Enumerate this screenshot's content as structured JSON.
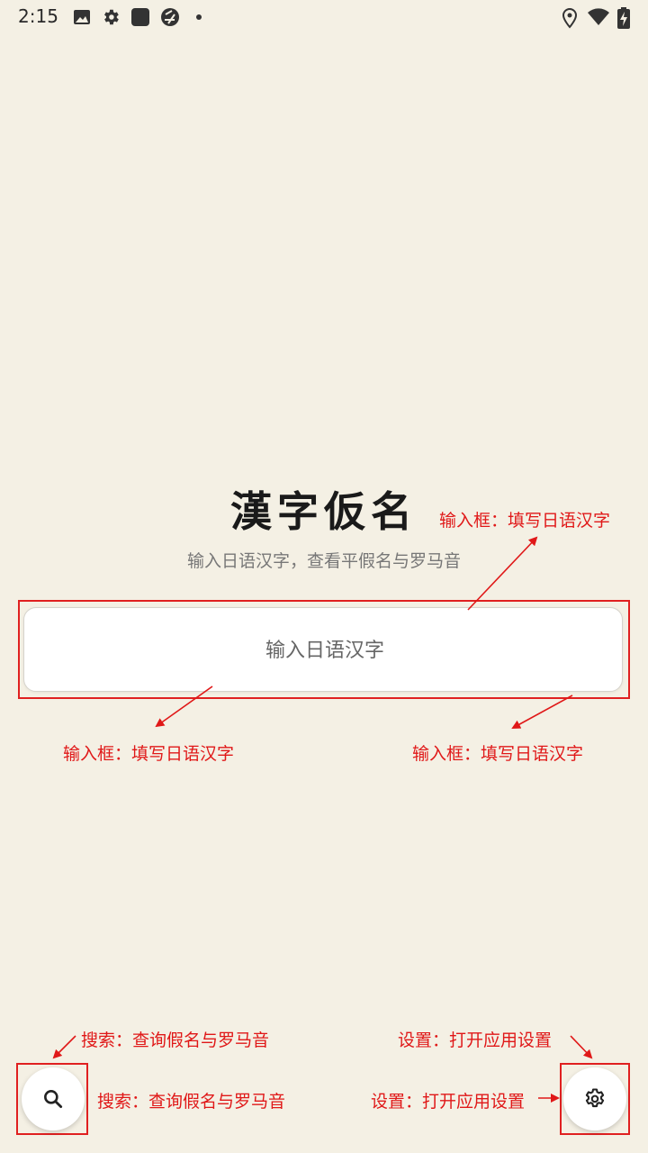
{
  "status_bar": {
    "time": "2:15",
    "left_icons": [
      "image-icon",
      "gear-icon",
      "app-square-icon",
      "sync-icon",
      "dot-icon"
    ],
    "right_icons": [
      "location-icon",
      "wifi-icon",
      "battery-charging-icon"
    ]
  },
  "main": {
    "title": "漢字仮名",
    "subtitle": "输入日语汉字，查看平假名与罗马音",
    "input": {
      "placeholder": "输入日语汉字",
      "value": ""
    }
  },
  "buttons": {
    "search_icon": "search-icon",
    "settings_icon": "gear-icon"
  },
  "annotations": {
    "input_top_right": "输入框：填写日语汉字",
    "input_bottom_left": "输入框：填写日语汉字",
    "input_bottom_right": "输入框：填写日语汉字",
    "search_top": "搜索：查询假名与罗马音",
    "search_side": "搜索：查询假名与罗马音",
    "settings_top": "设置：打开应用设置",
    "settings_side": "设置：打开应用设置"
  },
  "colors": {
    "background": "#f4f0e4",
    "annotation": "#e01818"
  }
}
